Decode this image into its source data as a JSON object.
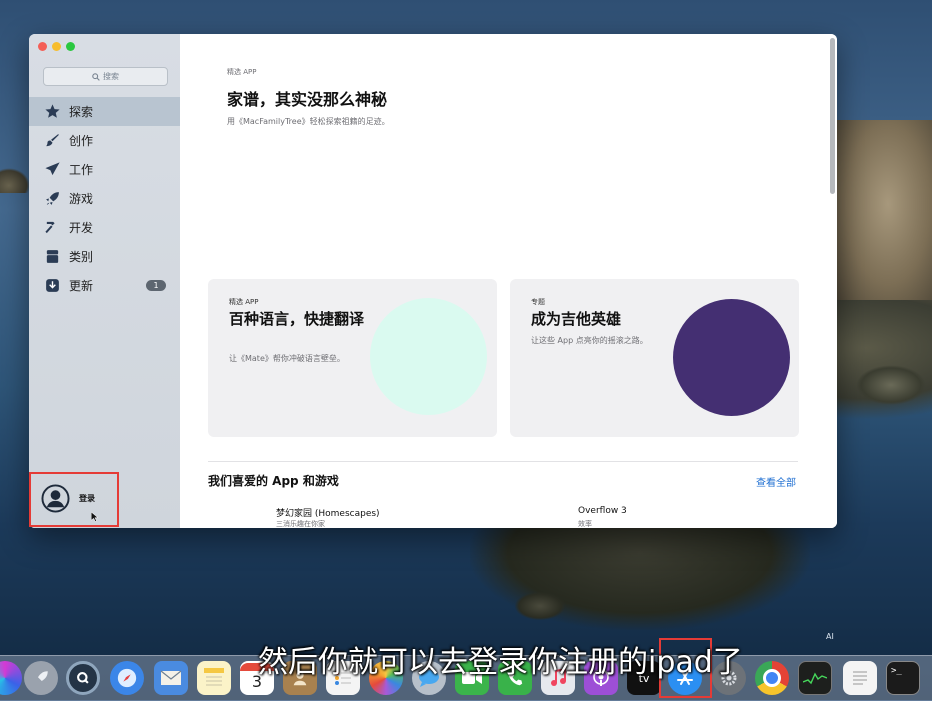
{
  "window": {
    "search_placeholder": "搜索",
    "sidebar": {
      "items": [
        {
          "label": "探索",
          "icon": "star-icon",
          "active": true
        },
        {
          "label": "创作",
          "icon": "brush-icon"
        },
        {
          "label": "工作",
          "icon": "paper-plane-icon"
        },
        {
          "label": "游戏",
          "icon": "rocket-icon"
        },
        {
          "label": "开发",
          "icon": "hammer-icon"
        },
        {
          "label": "类别",
          "icon": "layers-icon"
        },
        {
          "label": "更新",
          "icon": "download-icon",
          "badge": "1"
        }
      ],
      "login_label": "登录"
    },
    "hero": {
      "eyebrow": "精选 APP",
      "title": "家谱，其实没那么神秘",
      "subtitle": "用《MacFamilyTree》轻松探索祖籍的足迹。"
    },
    "cards": [
      {
        "eyebrow": "精选 APP",
        "title": "百种语言，快捷翻译",
        "subtitle": "让《Mate》帮你冲破语言壁垒。",
        "art_color": "#dafaf0"
      },
      {
        "eyebrow": "专题",
        "title": "成为吉他英雄",
        "subtitle": "让这些 App 点亮你的摇滚之路。",
        "art_color": "#442f72"
      }
    ],
    "section": {
      "title": "我们喜爱的 App 和游戏",
      "see_all": "查看全部",
      "games": [
        {
          "name": "梦幻家园 (Homescapes)",
          "subtitle": "三消乐趣在你家"
        },
        {
          "name": "Overflow 3",
          "subtitle": "效率"
        }
      ]
    }
  },
  "dock": {
    "icons": [
      "siri-icon",
      "launchpad-icon",
      "quicktime-icon",
      "safari-icon",
      "mail-icon",
      "notes-icon",
      "calendar-icon",
      "contacts-icon",
      "reminders-icon",
      "photos-icon",
      "messages-icon",
      "facetime-icon",
      "music-icon",
      "podcasts-icon",
      "tv-icon",
      "app-store-icon",
      "system-preferences-icon",
      "chrome-icon",
      "activity-monitor-icon",
      "textedit-icon",
      "terminal-icon"
    ],
    "calendar_day": "3",
    "tv_label": "tv"
  },
  "subtitle": "然后你就可以去登录你注册的ipad了",
  "ai_tag": "AI",
  "colors": {
    "accent_link": "#1f6fd2",
    "highlight_box": "#e53b36"
  }
}
